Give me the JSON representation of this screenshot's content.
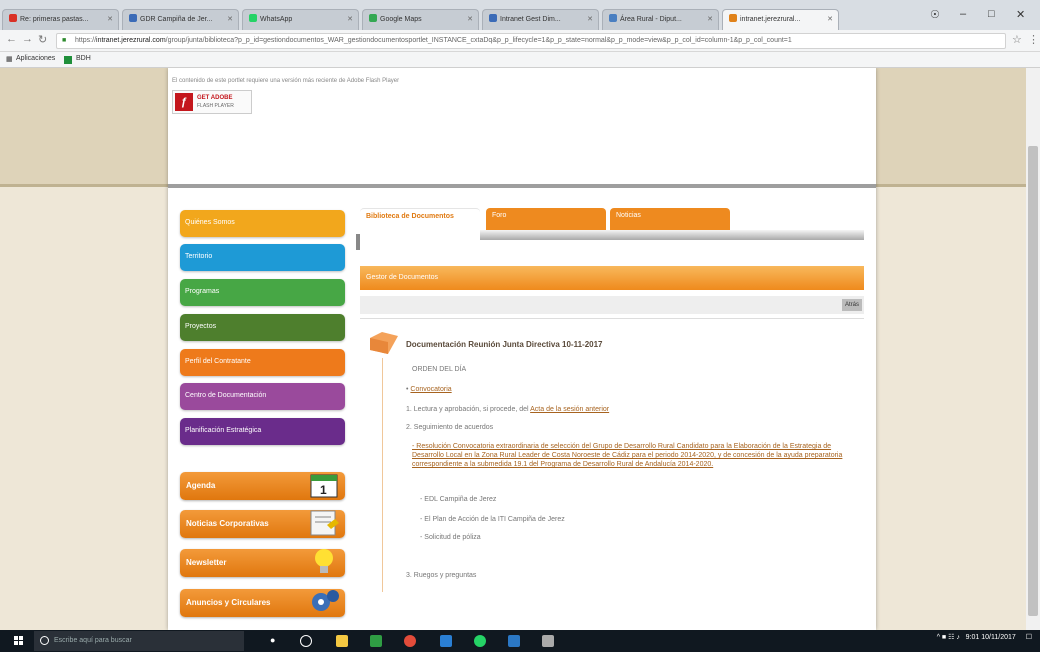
{
  "browser": {
    "tabs": [
      {
        "label": "Re: primeras pastas...",
        "color": "#d93025"
      },
      {
        "label": "GDR Campiña de Jer...",
        "color": "#3b6bb7"
      },
      {
        "label": "WhatsApp",
        "color": "#25d366"
      },
      {
        "label": "Google Maps",
        "color": "#34a853"
      },
      {
        "label": "Intranet Gest Dim...",
        "color": "#3b6bb7"
      },
      {
        "label": "Área Rural - Diput...",
        "color": "#4a7fc1"
      },
      {
        "label": "intranet.jerezrural...",
        "color": "#e0821a"
      }
    ],
    "url_scheme": "https://",
    "url_domain": "intranet.jerezrural.com",
    "url_path": "/group/junta/biblioteca?p_p_id=gestiondocumentos_WAR_gestiondocumentosportlet_INSTANCE_cxtaDq&p_p_lifecycle=1&p_p_state=normal&p_p_mode=view&p_p_col_id=column-1&p_p_col_count=1",
    "bookmarks": {
      "apps": "Aplicaciones",
      "item1": "BDH"
    }
  },
  "header": {
    "flash_note": "El contenido de este portlet requiere una versión más reciente de Adobe Flash Player",
    "adobe_title": "GET ADOBE",
    "adobe_sub": "FLASH PLAYER"
  },
  "menu": {
    "items": [
      {
        "label": "Quiénes Somos",
        "color": "#f2a71c"
      },
      {
        "label": "Territorio",
        "color": "#1e9ad6"
      },
      {
        "label": "Programas",
        "color": "#47a745"
      },
      {
        "label": "Proyectos",
        "color": "#4e7f2d"
      },
      {
        "label": "Perfil del Contratante",
        "color": "#ee7a1b"
      },
      {
        "label": "Centro de Documentación",
        "color": "#9a4a9c"
      },
      {
        "label": "Planificación Estratégica",
        "color": "#6a2c8b"
      }
    ],
    "cards": [
      {
        "label": "Agenda"
      },
      {
        "label": "Noticias Corporativas"
      },
      {
        "label": "Newsletter"
      },
      {
        "label": "Anuncios y Circulares"
      }
    ]
  },
  "tabs": {
    "selected": "Biblioteca de Documentos",
    "tab2": "Foro",
    "tab3": "Noticias"
  },
  "section": {
    "header": "Gestor de Documentos",
    "btn": "Atrás"
  },
  "document": {
    "title": "Documentación Reunión Junta Directiva 10-11-2017",
    "orden": "ORDEN DEL DÍA",
    "convocatoria": "Convocatoria",
    "p1_text": "1. Lectura y aprobación, si procede, del",
    "p1_link": "Acta de la sesión anterior",
    "p2": "2. Seguimiento de acuerdos",
    "resolucion": "- Resolución Convocatoria extraordinaria de selección del Grupo de Desarrollo Rural Candidato para la Elaboración de la Estrategia de Desarrollo Local en la Zona Rural Leader de Costa Noroeste de Cádiz para el periodo 2014-2020, y de concesión de la ayuda preparatoria correspondiente a la submedida 19.1 del Programa de Desarrollo Rural de Andalucía 2014-2020.",
    "sub1": "- EDL Campiña de Jerez",
    "sub2": "- El Plan de Acción de la ITI Campiña de Jerez",
    "sub3": "- Solicitud de póliza",
    "p3": "3. Ruegos y preguntas"
  },
  "taskbar": {
    "search_placeholder": "Escribe aquí para buscar",
    "time": "9:01",
    "date": "10/11/2017"
  }
}
